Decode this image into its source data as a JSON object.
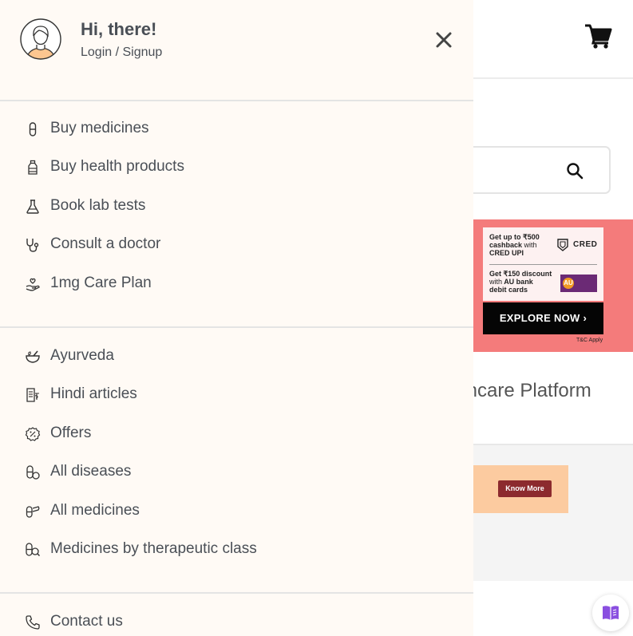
{
  "drawer": {
    "greeting": "Hi, there!",
    "login_label": "Login / Signup",
    "sections": [
      {
        "items": [
          {
            "label": "Buy medicines",
            "icon": "pill-icon"
          },
          {
            "label": "Buy health products",
            "icon": "bottle-icon"
          },
          {
            "label": "Book lab tests",
            "icon": "flask-icon"
          },
          {
            "label": "Consult a doctor",
            "icon": "stethoscope-icon"
          },
          {
            "label": "1mg Care Plan",
            "icon": "care-hand-icon"
          }
        ]
      },
      {
        "items": [
          {
            "label": "Ayurveda",
            "icon": "mortar-icon"
          },
          {
            "label": "Hindi articles",
            "icon": "article-icon"
          },
          {
            "label": "Offers",
            "icon": "offer-icon"
          },
          {
            "label": "All diseases",
            "icon": "diseases-icon"
          },
          {
            "label": "All medicines",
            "icon": "medicines-icon"
          },
          {
            "label": "Medicines by therapeutic class",
            "icon": "therapeutic-icon"
          }
        ]
      },
      {
        "items": [
          {
            "label": "Contact us",
            "icon": "phone-icon"
          }
        ]
      }
    ]
  },
  "background": {
    "cred_banner": {
      "line1_a": "Get up to ₹500",
      "line1_b": "cashback",
      "line1_c": "with",
      "line1_d": "CRED UPI",
      "cred_logo": "CRED",
      "line2_a": "Get ₹150 discount",
      "line2_b": "with",
      "line2_c": "AU bank",
      "line2_d": "debit cards",
      "au_logo": "AU",
      "cta": "EXPLORE NOW ›",
      "terms": "T&C Apply"
    },
    "platform_text": "thcare Platform",
    "promo_cta": "Know More"
  },
  "colors": {
    "drawer_bg": "#fffaf5",
    "text": "#4a4f56",
    "cred_banner_bg": "#f47b7b",
    "promo_banner_bg": "#fccba0",
    "promo_button": "#8c2a2e",
    "read_icon": "#8a4fe0"
  }
}
